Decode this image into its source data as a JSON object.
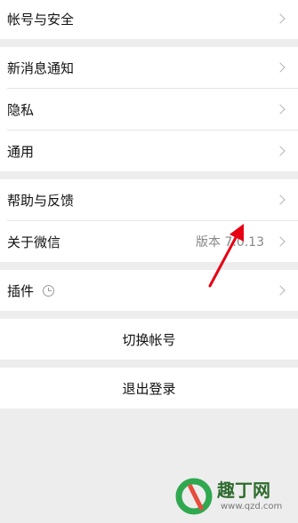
{
  "settings": {
    "account_security": "帐号与安全",
    "new_message_notify": "新消息通知",
    "privacy": "隐私",
    "general": "通用",
    "help_feedback": "帮助与反馈",
    "about_wechat": "关于微信",
    "version": "版本 7.0.13",
    "plugins": "插件",
    "switch_account": "切换帐号",
    "logout": "退出登录"
  },
  "watermark": {
    "site_name": "趣丁网",
    "site_url": "www.qzd.com"
  },
  "colors": {
    "annotation_arrow": "#e60012",
    "background": "#ededed"
  }
}
